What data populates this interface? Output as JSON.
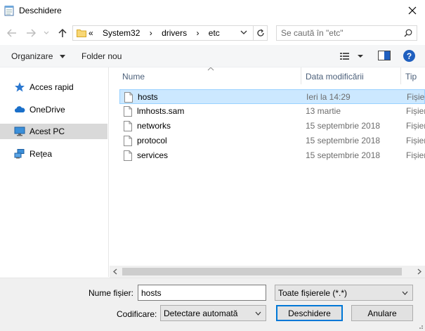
{
  "window": {
    "title": "Deschidere"
  },
  "nav": {
    "breadcrumb": [
      "«",
      "System32",
      "›",
      "drivers",
      "›",
      "etc"
    ],
    "search_placeholder": "Se caută în \"etc\""
  },
  "toolbar": {
    "organize_label": "Organizare",
    "new_folder_label": "Folder nou",
    "help_label": "?"
  },
  "sidebar": {
    "items": [
      {
        "label": "Acces rapid",
        "icon": "star-icon",
        "selected": false
      },
      {
        "label": "OneDrive",
        "icon": "cloud-icon",
        "selected": false
      },
      {
        "label": "Acest PC",
        "icon": "computer-icon",
        "selected": true
      },
      {
        "label": "Rețea",
        "icon": "network-icon",
        "selected": false
      }
    ]
  },
  "filelist": {
    "columns": {
      "name": "Nume",
      "date": "Data modificării",
      "type": "Tip"
    },
    "rows": [
      {
        "name": "hosts",
        "date": "Ieri la 14:29",
        "type": "Fișier",
        "selected": true
      },
      {
        "name": "lmhosts.sam",
        "date": "13 martie",
        "type": "Fișier",
        "selected": false
      },
      {
        "name": "networks",
        "date": "15 septembrie 2018",
        "type": "Fișier",
        "selected": false
      },
      {
        "name": "protocol",
        "date": "15 septembrie 2018",
        "type": "Fișier",
        "selected": false
      },
      {
        "name": "services",
        "date": "15 septembrie 2018",
        "type": "Fișier",
        "selected": false
      }
    ]
  },
  "bottom": {
    "filename_label": "Nume fișier:",
    "filename_value": "hosts",
    "filter_value": "Toate fișierele (*.*)",
    "encoding_label": "Codificare:",
    "encoding_value": "Detectare automată",
    "open_label": "Deschidere",
    "cancel_label": "Anulare"
  },
  "colors": {
    "selection_bg": "#cce8ff",
    "selection_border": "#99d1ff",
    "accent": "#0078d7",
    "header_text": "#4c607a"
  }
}
